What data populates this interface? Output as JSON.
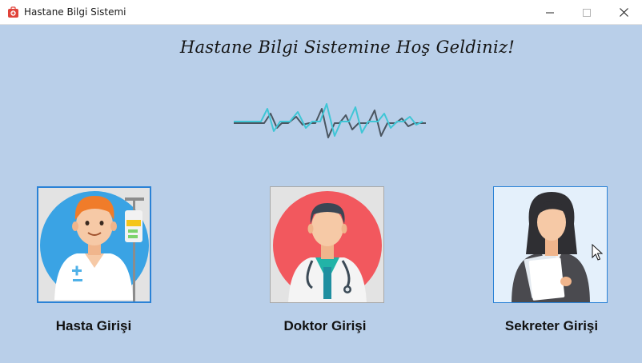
{
  "window": {
    "title": "Hastane Bilgi Sistemi",
    "icon": "first-aid-kit-icon",
    "controls": [
      "minimize-icon",
      "maximize-icon",
      "close-icon"
    ]
  },
  "header": {
    "welcome_text": "Hastane Bilgi Sistemine Hoş Geldiniz!"
  },
  "roles": [
    {
      "label": "Hasta Girişi",
      "icon": "patient-icon"
    },
    {
      "label": "Doktor Girişi",
      "icon": "doctor-icon"
    },
    {
      "label": "Sekreter Girişi",
      "icon": "secretary-icon"
    }
  ],
  "colors": {
    "background": "#b9cfe9",
    "heartbeat_teal": "#3fc6d6",
    "heartbeat_dark": "#4a5560",
    "focus_border": "#2a82d6"
  }
}
